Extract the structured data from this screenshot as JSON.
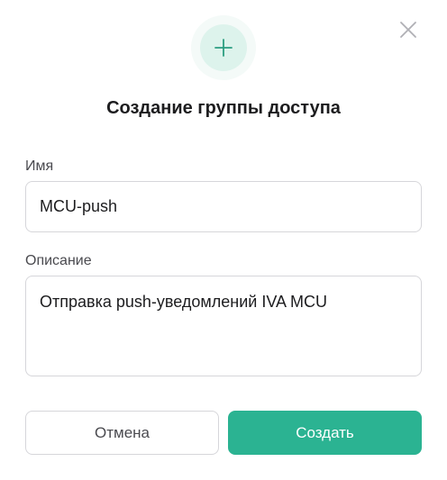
{
  "dialog": {
    "title": "Создание группы доступа",
    "header_icon": "plus-icon",
    "close_icon": "close-icon",
    "accent_color": "#2bb392"
  },
  "form": {
    "name_label": "Имя",
    "name_value": "MCU-push",
    "description_label": "Описание",
    "description_value": "Отправка push-уведомлений IVA MCU"
  },
  "actions": {
    "cancel_label": "Отмена",
    "create_label": "Создать"
  }
}
